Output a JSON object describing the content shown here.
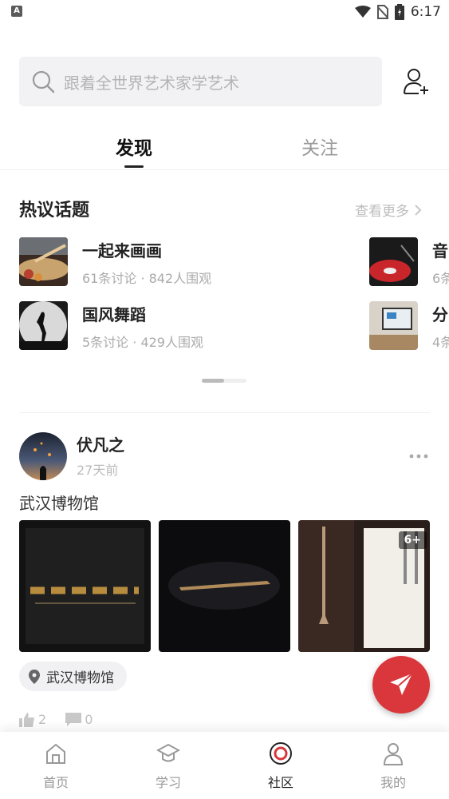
{
  "status_bar": {
    "time": "6:17",
    "left_badge": "A"
  },
  "search": {
    "placeholder": "跟着全世界艺术家学艺术"
  },
  "tabs": [
    {
      "label": "发现",
      "active": true
    },
    {
      "label": "关注",
      "active": false
    }
  ],
  "hot_topics": {
    "title": "热议话题",
    "see_more": "查看更多",
    "items": [
      {
        "name": "一起来画画",
        "meta": "61条讨论 · 842人围观"
      },
      {
        "name": "国风舞蹈",
        "meta": "5条讨论 · 429人围观"
      },
      {
        "name": "音",
        "meta": "6条"
      },
      {
        "name": "分",
        "meta": "4条"
      }
    ]
  },
  "post": {
    "author": "伏凡之",
    "time": "27天前",
    "text": "武汉博物馆",
    "more_photos": "6+",
    "location": "武汉博物馆",
    "likes": "2",
    "comments": "0"
  },
  "bottom_nav": [
    {
      "label": "首页",
      "icon": "home-icon",
      "active": false
    },
    {
      "label": "学习",
      "icon": "graduation-cap-icon",
      "active": false
    },
    {
      "label": "社区",
      "icon": "community-target-icon",
      "active": true
    },
    {
      "label": "我的",
      "icon": "user-icon",
      "active": false
    }
  ],
  "colors": {
    "accent": "#d9373b",
    "search_bg": "#f2f2f4"
  }
}
